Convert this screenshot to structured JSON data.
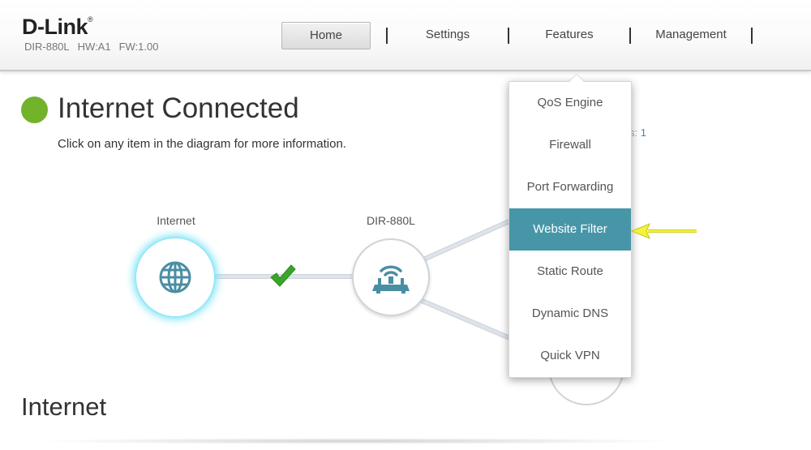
{
  "brand": {
    "logo": "D-Link",
    "registered": "®",
    "model": "DIR-880L",
    "hw": "HW:A1",
    "fw": "FW:1.00"
  },
  "nav": {
    "home": "Home",
    "settings": "Settings",
    "features": "Features",
    "management": "Management",
    "active": "Home"
  },
  "status": {
    "title": "Internet Connected",
    "subtitle": "Click on any item in the diagram for more information.",
    "color": "#73b32c"
  },
  "diagram": {
    "internet_label": "Internet",
    "router_label": "DIR-880L",
    "clients_peek": "s:",
    "clients_count": "1",
    "link_ok_color": "#3aa52a",
    "glow_color": "#7fe3f6",
    "icon_color": "#4a8ea3"
  },
  "features_menu": {
    "items": [
      {
        "label": "QoS Engine"
      },
      {
        "label": "Firewall"
      },
      {
        "label": "Port Forwarding"
      },
      {
        "label": "Website Filter"
      },
      {
        "label": "Static Route"
      },
      {
        "label": "Dynamic DNS"
      },
      {
        "label": "Quick VPN"
      }
    ],
    "highlighted": "Website Filter",
    "highlight_color": "#4796a8"
  },
  "annotation": {
    "arrow_color": "#f3f33a"
  },
  "section": {
    "title": "Internet"
  }
}
